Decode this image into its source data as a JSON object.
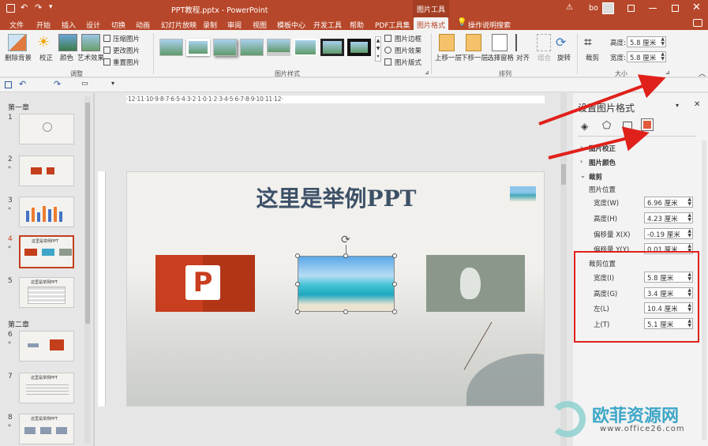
{
  "titlebar": {
    "doc_title": "PPT教程.pptx  -  PowerPoint",
    "context_tab": "图片工具",
    "user": "bo"
  },
  "tabs": [
    "文件",
    "开始",
    "插入",
    "设计",
    "切换",
    "动画",
    "幻灯片放映",
    "录制",
    "审阅",
    "视图",
    "模板中心",
    "开发工具",
    "帮助",
    "PDF工具集",
    "图片格式"
  ],
  "search_hint": "操作说明搜索",
  "ribbon": {
    "adjust": {
      "remove_bg": "删除背景",
      "correct": "校正",
      "color": "颜色",
      "artistic": "艺术效果",
      "compress": "压缩图片",
      "change": "更改图片",
      "reset": "重置图片",
      "group_label": "调整"
    },
    "styles": {
      "border": "图片边框",
      "effects": "图片效果",
      "layout": "图片版式",
      "group_label": "图片样式"
    },
    "arrange": {
      "bring_forward": "上移一层",
      "send_backward": "下移一层",
      "selection_pane": "选择窗格",
      "align": "对齐",
      "group": "组合",
      "rotate": "旋转",
      "group_label": "排列"
    },
    "size": {
      "crop": "裁剪",
      "height_label": "高度:",
      "height_value": "5.8 厘米",
      "width_label": "宽度:",
      "width_value": "5.8 厘米",
      "group_label": "大小"
    }
  },
  "ruler_ticks": "·12·11·10·9·8·7·6·5·4·3·2·1·0·1·2·3·4·5·6·7·8·9·10·11·12·",
  "slides_panel": {
    "section1": "第一章",
    "section2": "第二章",
    "slides": [
      {
        "num": "1",
        "star": ""
      },
      {
        "num": "2",
        "star": "*"
      },
      {
        "num": "3",
        "star": "*"
      },
      {
        "num": "4",
        "star": "*"
      },
      {
        "num": "5",
        "star": ""
      },
      {
        "num": "6",
        "star": "*"
      },
      {
        "num": "7",
        "star": ""
      },
      {
        "num": "8",
        "star": "*"
      }
    ],
    "thumb_texts": {
      "s4": "这里是举例PPT",
      "s5": "这里是举例PPT",
      "s7": "这里是举例PPT",
      "s8": "这里是举例PPT"
    }
  },
  "slide": {
    "title": "这里是举例PPT",
    "ppt_letter": "P"
  },
  "format_pane": {
    "title": "设置图片格式",
    "picture_correction": "图片校正",
    "picture_color": "图片颜色",
    "crop": "裁剪",
    "picture_position": "图片位置",
    "fields_position": [
      {
        "label": "宽度(W)",
        "value": "6.96 厘米"
      },
      {
        "label": "高度(H)",
        "value": "4.23 厘米"
      },
      {
        "label": "偏移量 X(X)",
        "value": "-0.19 厘米"
      },
      {
        "label": "偏移量 Y(Y)",
        "value": "0.01 厘米"
      }
    ],
    "crop_position": "裁剪位置",
    "fields_crop": [
      {
        "label": "宽度(I)",
        "value": "5.8 厘米"
      },
      {
        "label": "高度(G)",
        "value": "3.4 厘米"
      },
      {
        "label": "左(L)",
        "value": "10.4 厘米"
      },
      {
        "label": "上(T)",
        "value": "5.1 厘米"
      }
    ]
  },
  "watermark": {
    "name": "欧菲资源网",
    "url": "www.office26.com"
  },
  "colors": {
    "accent": "#b7472a",
    "annotation": "#e0201b"
  }
}
